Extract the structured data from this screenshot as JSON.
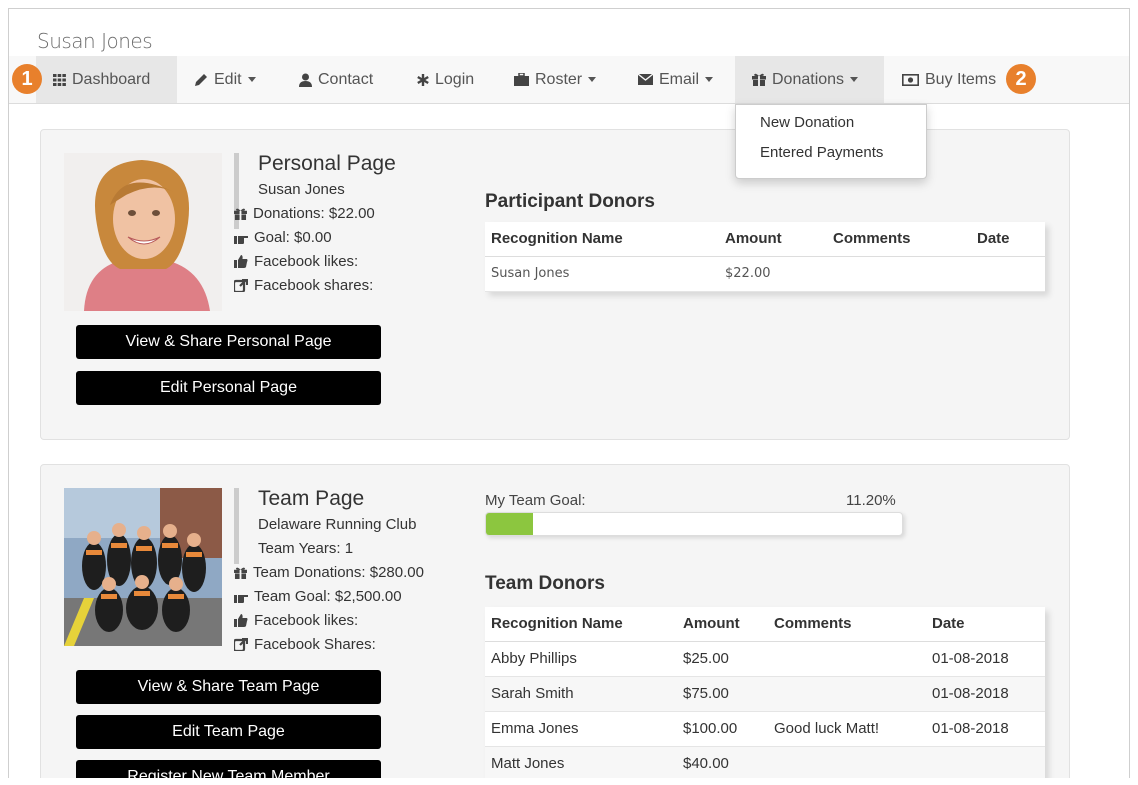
{
  "header": {
    "user_name": "Susan Jones"
  },
  "nav": {
    "items": [
      {
        "label": "Dashboard",
        "icon": "dashboard-icon",
        "active": true
      },
      {
        "label": "Edit",
        "icon": "pencil-icon",
        "dropdown": true
      },
      {
        "label": "Contact",
        "icon": "user-icon"
      },
      {
        "label": "Login",
        "icon": "asterisk-icon"
      },
      {
        "label": "Roster",
        "icon": "briefcase-icon",
        "dropdown": true
      },
      {
        "label": "Email",
        "icon": "envelope-icon",
        "dropdown": true
      },
      {
        "label": "Donations",
        "icon": "gift-icon",
        "dropdown": true,
        "open": true
      },
      {
        "label": "Buy Items",
        "icon": "money-icon"
      }
    ],
    "callouts": [
      "1",
      "2"
    ],
    "donations_menu": [
      "New Donation",
      "Entered Payments"
    ]
  },
  "personal": {
    "title": "Personal Page",
    "name": "Susan Jones",
    "donations": "Donations: $22.00",
    "goal": "Goal: $0.00",
    "fb_likes": "Facebook likes:",
    "fb_shares": "Facebook shares:",
    "btn_view_share": "View & Share Personal Page",
    "btn_edit": "Edit Personal Page",
    "donors_title": "Participant Donors",
    "columns": [
      "Recognition Name",
      "Amount",
      "Comments",
      "Date"
    ],
    "rows": [
      {
        "name": "Susan Jones",
        "amount": "$22.00",
        "comments": "",
        "date": ""
      }
    ]
  },
  "team": {
    "title": "Team Page",
    "name": "Delaware Running Club",
    "years": "Team Years: 1",
    "donations": "Team Donations: $280.00",
    "goal": "Team Goal: $2,500.00",
    "fb_likes": "Facebook likes:",
    "fb_shares": "Facebook Shares:",
    "btn_view_share": "View & Share Team Page",
    "btn_edit": "Edit Team Page",
    "btn_register": "Register New Team Member",
    "goal_label": "My Team Goal:",
    "goal_percent_text": "11.20%",
    "goal_fraction": 0.112,
    "donors_title": "Team Donors",
    "columns": [
      "Recognition Name",
      "Amount",
      "Comments",
      "Date"
    ],
    "rows": [
      {
        "name": "Abby Phillips",
        "amount": "$25.00",
        "comments": "",
        "date": "01-08-2018"
      },
      {
        "name": "Sarah Smith",
        "amount": "$75.00",
        "comments": "",
        "date": "01-08-2018"
      },
      {
        "name": "Emma Jones",
        "amount": "$100.00",
        "comments": "Good luck Matt!",
        "date": "01-08-2018"
      },
      {
        "name": "Matt Jones",
        "amount": "$40.00",
        "comments": "",
        "date": ""
      }
    ]
  },
  "colors": {
    "accent_orange": "#e8802c",
    "progress_green": "#8cc63f",
    "button_black": "#000000"
  }
}
